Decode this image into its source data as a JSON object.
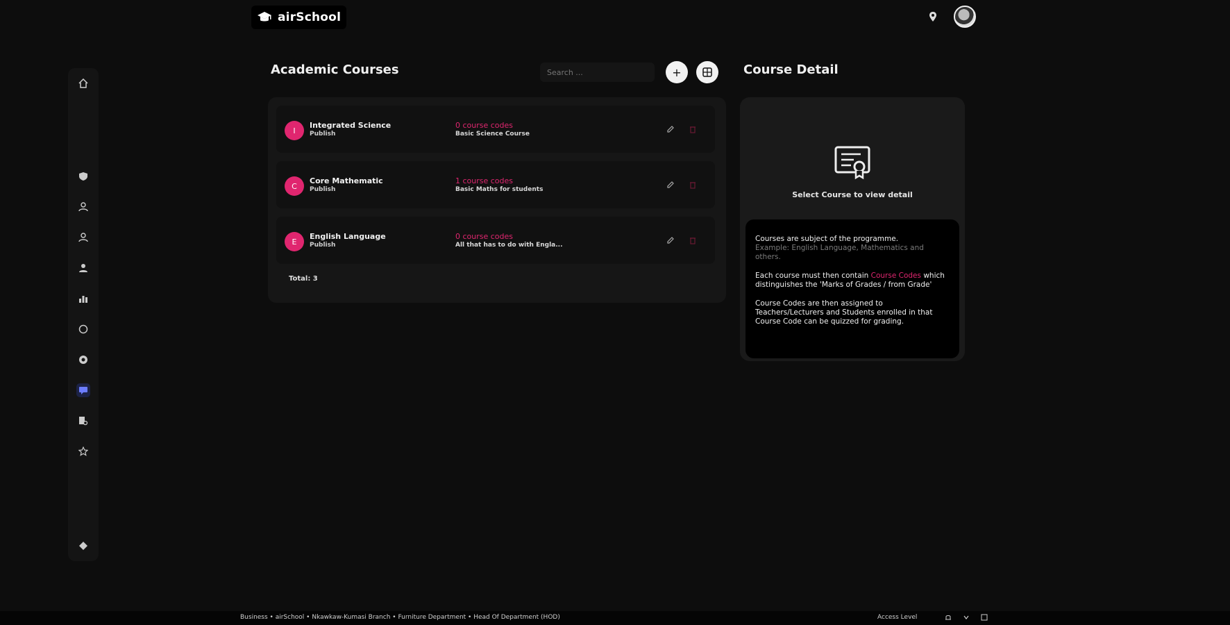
{
  "app": {
    "name": "airSchool"
  },
  "sidebar": {
    "items": [
      {
        "name": "home",
        "icon": "home-icon",
        "active": false
      },
      {
        "name": "security",
        "icon": "shield-icon",
        "active": false
      },
      {
        "name": "user1",
        "icon": "user-icon",
        "active": false
      },
      {
        "name": "user2",
        "icon": "user-icon",
        "active": false
      },
      {
        "name": "user3",
        "icon": "user-icon",
        "active": false
      },
      {
        "name": "reports",
        "icon": "bar-chart-icon",
        "active": false
      },
      {
        "name": "settings",
        "icon": "circle-icon",
        "active": false
      },
      {
        "name": "support",
        "icon": "lifebuoy-icon",
        "active": false
      },
      {
        "name": "courses",
        "icon": "chat-screen-icon",
        "active": true
      },
      {
        "name": "search-docs",
        "icon": "doc-search-icon",
        "active": false
      },
      {
        "name": "favorites",
        "icon": "star-icon",
        "active": false
      },
      {
        "name": "extra",
        "icon": "diamond-icon",
        "active": false
      }
    ]
  },
  "main": {
    "title": "Academic Courses",
    "search_placeholder": "Search ...",
    "add_label": "+",
    "courses": [
      {
        "initial": "I",
        "name": "Integrated Science",
        "subtitle": "Publish",
        "codes": "0 course codes",
        "description": "Basic Science Course"
      },
      {
        "initial": "C",
        "name": "Core Mathematic",
        "subtitle": "Publish",
        "codes": "1 course codes",
        "description": "Basic Maths for students"
      },
      {
        "initial": "E",
        "name": "English Language",
        "subtitle": "Publish",
        "codes": "0 course codes",
        "description": "All that has to do with Engla..."
      }
    ],
    "total": "Total: 3"
  },
  "detail": {
    "title": "Course Detail",
    "empty_text": "Select Course to view detail",
    "info": {
      "p1_strong": "Courses are subject of the programme.",
      "p1_muted": "Example: English Language, Mathematics and others.",
      "p2_a": "Each course must then contain ",
      "p2_pink": "Course Codes",
      "p2_b": " which distinguishes the 'Marks of Grades / from Grade'",
      "p3": "Course Codes are then assigned to Teachers/Lecturers and Students enrolled in that Course Code can be quizzed for grading."
    }
  },
  "status": {
    "path": "Business • airSchool • Nkawkaw-Kumasi Branch • Furniture Department • Head Of Department (HOD)",
    "access": "Access Level"
  },
  "colors": {
    "accent": "#e0266f",
    "background": "#0d0d0d",
    "active_nav": "#6c7dff"
  }
}
